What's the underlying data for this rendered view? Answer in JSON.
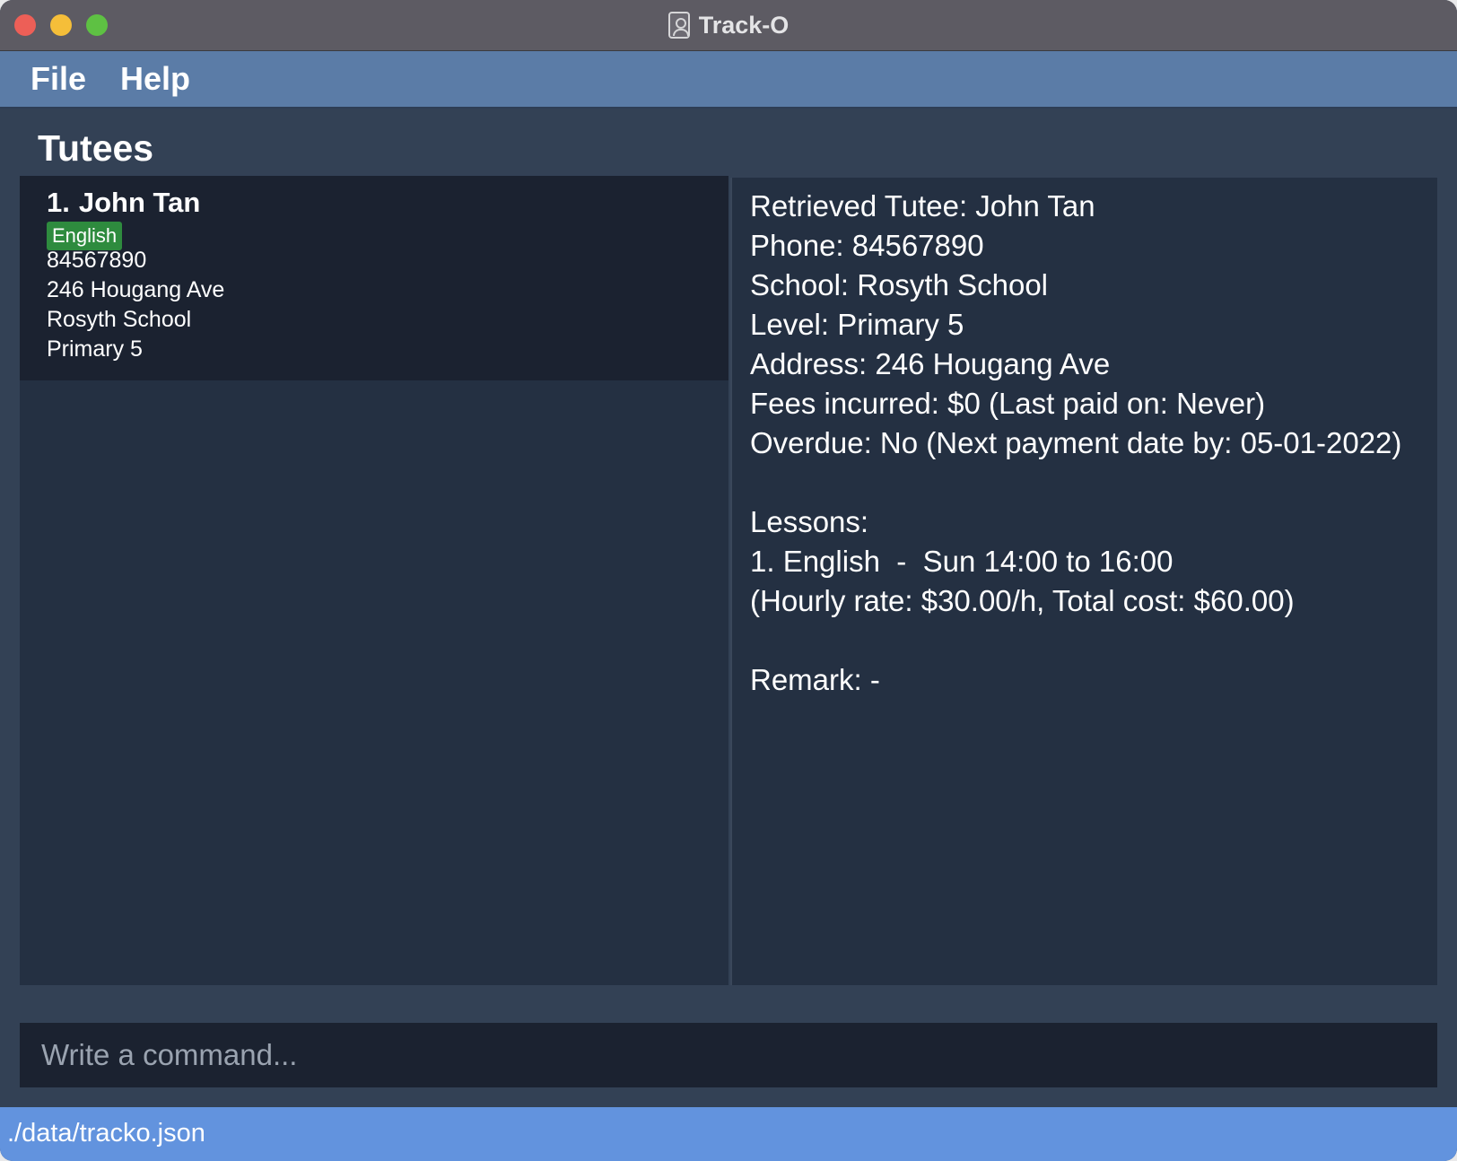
{
  "window": {
    "title": "Track-O"
  },
  "menu": {
    "file": "File",
    "help": "Help"
  },
  "tutees": {
    "heading": "Tutees",
    "list": [
      {
        "index": "1.",
        "name": "John Tan",
        "tag": "English",
        "phone": "84567890",
        "address": "246 Hougang Ave",
        "school": "Rosyth School",
        "level": "Primary 5"
      }
    ]
  },
  "details": {
    "retrieved": "Retrieved Tutee: John Tan",
    "phone": "Phone: 84567890",
    "school": "School: Rosyth School",
    "level": "Level: Primary 5",
    "address": "Address: 246 Hougang Ave",
    "fees": "Fees incurred: $0 (Last paid on: Never)",
    "overdue": "Overdue: No (Next payment date by: 05-01-2022)",
    "lessons_heading": "Lessons:",
    "lesson_1": "1. English  -  Sun 14:00 to 16:00",
    "lesson_1_rate": "(Hourly rate: $30.00/h, Total cost: $60.00)",
    "remark": "Remark: -"
  },
  "command": {
    "placeholder": "Write a command..."
  },
  "status": {
    "file_path": "./data/tracko.json"
  },
  "colors": {
    "menubar": "#5b7ca7",
    "background": "#334155",
    "panel": "#243042",
    "card": "#1b2230",
    "tag": "#2e8b3e",
    "statusbar": "#6293de"
  },
  "icons": {
    "app": "address-book-icon"
  }
}
